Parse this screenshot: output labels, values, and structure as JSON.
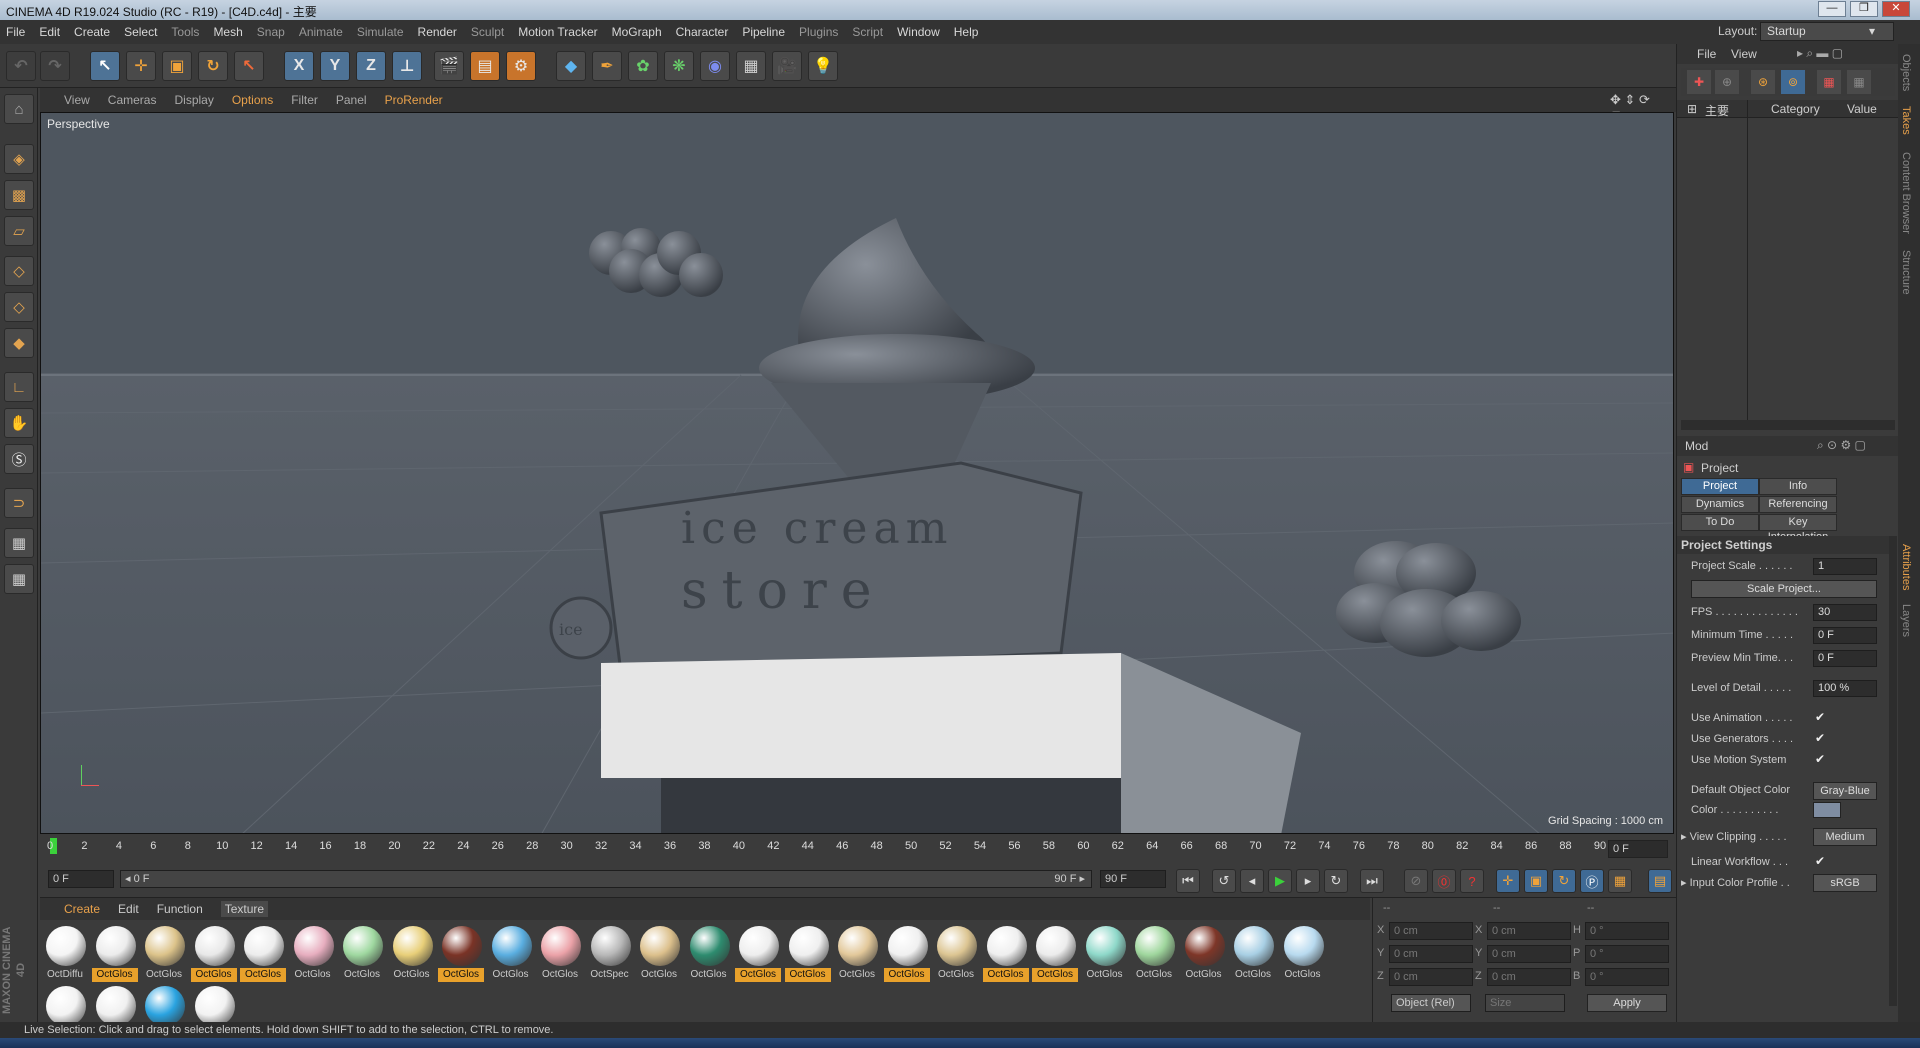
{
  "window": {
    "title": "CINEMA 4D R19.024 Studio (RC - R19) - [C4D.c4d] - 主要",
    "min": "—",
    "max": "❐",
    "close": "✕"
  },
  "menu": [
    "File",
    "Edit",
    "Create",
    "Select",
    "Tools",
    "Mesh",
    "Snap",
    "Animate",
    "Simulate",
    "Render",
    "Sculpt",
    "Motion Tracker",
    "MoGraph",
    "Character",
    "Pipeline",
    "Plugins",
    "Script",
    "Window",
    "Help"
  ],
  "layout": {
    "label": "Layout:",
    "value": "Startup"
  },
  "toolbar": {
    "x": "X",
    "y": "Y",
    "z": "Z"
  },
  "viewport_menu": [
    "View",
    "Cameras",
    "Display",
    "Options",
    "Filter",
    "Panel",
    "ProRender"
  ],
  "viewport": {
    "label": "Perspective",
    "grid_spacing": "Grid Spacing : 1000 cm",
    "sign_line1": "ice cream",
    "sign_line2": "store",
    "badge": "ice"
  },
  "timeline": {
    "ticks": [
      "0",
      "2",
      "4",
      "6",
      "8",
      "10",
      "12",
      "14",
      "16",
      "18",
      "20",
      "22",
      "24",
      "26",
      "28",
      "30",
      "32",
      "34",
      "36",
      "38",
      "40",
      "42",
      "44",
      "46",
      "48",
      "50",
      "52",
      "54",
      "56",
      "58",
      "60",
      "62",
      "64",
      "66",
      "68",
      "70",
      "72",
      "74",
      "76",
      "78",
      "80",
      "82",
      "84",
      "86",
      "88",
      "90"
    ],
    "current_frame": "0 F"
  },
  "transport": {
    "start": "0 F",
    "slider_start": "◂ 0 F",
    "slider_end": "90 F ▸",
    "end": "90 F"
  },
  "material_tabs": [
    "Create",
    "Edit",
    "Function",
    "Texture"
  ],
  "materials": [
    {
      "label": "OctDiffu",
      "color": "#f4f4f4",
      "sel": false
    },
    {
      "label": "OctGlos",
      "color": "#ececec",
      "sel": true
    },
    {
      "label": "OctGlos",
      "color": "#dcc38a",
      "sel": false
    },
    {
      "label": "OctGlos",
      "color": "#e8e8e8",
      "sel": true
    },
    {
      "label": "OctGlos",
      "color": "#ededed",
      "sel": true
    },
    {
      "label": "OctGlos",
      "color": "#e7aebf",
      "sel": false
    },
    {
      "label": "OctGlos",
      "color": "#9fd8a0",
      "sel": false
    },
    {
      "label": "OctGlos",
      "color": "#e8cf79",
      "sel": false
    },
    {
      "label": "OctGlos",
      "color": "#7a3326",
      "sel": true
    },
    {
      "label": "OctGlos",
      "color": "#5aaee0",
      "sel": false
    },
    {
      "label": "OctGlos",
      "color": "#eba2a8",
      "sel": false
    },
    {
      "label": "OctSpec",
      "color": "#b8b8b8",
      "sel": false
    },
    {
      "label": "OctGlos",
      "color": "#dcc08c",
      "sel": false
    },
    {
      "label": "OctGlos",
      "color": "#2e8c6f",
      "sel": false
    },
    {
      "label": "OctGlos",
      "color": "#eeeeee",
      "sel": true
    },
    {
      "label": "OctGlos",
      "color": "#efefef",
      "sel": true
    },
    {
      "label": "OctGlos",
      "color": "#e2c89a",
      "sel": false
    },
    {
      "label": "OctGlos",
      "color": "#f0f0f0",
      "sel": true
    },
    {
      "label": "OctGlos",
      "color": "#dcc592",
      "sel": false
    },
    {
      "label": "OctGlos",
      "color": "#efefef",
      "sel": true
    },
    {
      "label": "OctGlos",
      "color": "#ececec",
      "sel": true
    },
    {
      "label": "OctGlos",
      "color": "#8ed8c9",
      "sel": false
    },
    {
      "label": "OctGlos",
      "color": "#9fd69d",
      "sel": false
    },
    {
      "label": "OctGlos",
      "color": "#7e3628",
      "sel": false
    },
    {
      "label": "OctGlos",
      "color": "#a8cfe4",
      "sel": false
    },
    {
      "label": "OctGlos",
      "color": "#b8daef",
      "sel": false
    }
  ],
  "materials_row2": [
    "#f2f2f2",
    "#f0f0f0",
    "#2aa3e0",
    "#f2f2f2"
  ],
  "coords": {
    "dashes": [
      "--",
      "--",
      "--"
    ],
    "rows": [
      {
        "a": "X",
        "av": "0 cm",
        "b": "X",
        "bv": "0 cm",
        "c": "H",
        "cv": "0 °"
      },
      {
        "a": "Y",
        "av": "0 cm",
        "b": "Y",
        "bv": "0 cm",
        "c": "P",
        "cv": "0 °"
      },
      {
        "a": "Z",
        "av": "0 cm",
        "b": "Z",
        "bv": "0 cm",
        "c": "B",
        "cv": "0 °"
      }
    ],
    "mode": "Object (Rel)",
    "size": "Size",
    "apply": "Apply"
  },
  "objects": {
    "menu": [
      "File",
      "View"
    ],
    "tree_root": "主要",
    "col_category": "Category",
    "col_value": "Value"
  },
  "attributes": {
    "mode": "Mod",
    "title": "Project",
    "tabs": [
      "Project Settings",
      "Info",
      "Dynamics",
      "Referencing",
      "To Do",
      "Key Interpolation"
    ],
    "section": "Project Settings",
    "scale_btn": "Scale Project...",
    "rows": [
      {
        "label": "Project Scale . . . . . .",
        "value": "1"
      },
      {
        "label": "FPS . . . . . . . . . . . . . .",
        "value": "30"
      },
      {
        "label": "Minimum Time . . . . .",
        "value": "0 F"
      },
      {
        "label": "Preview Min Time. . .",
        "value": "0 F"
      },
      {
        "label": "Level of Detail . . . . .",
        "value": "100 %"
      }
    ],
    "checks": [
      {
        "label": "Use Animation . . . . .",
        "mark": "✔"
      },
      {
        "label": "Use Generators . . . .",
        "mark": "✔"
      },
      {
        "label": "Use Motion System",
        "mark": "✔"
      }
    ],
    "default_color": {
      "label": "Default Object Color",
      "value": "Gray-Blue"
    },
    "color": {
      "label": "Color . . . . . . . . . .",
      "swatch": "#7f8da2"
    },
    "clipping": {
      "label": "View Clipping . . . . .",
      "value": "Medium"
    },
    "linear": {
      "label": "Linear Workflow . . .",
      "mark": "✔"
    },
    "profile": {
      "label": "Input Color Profile . .",
      "value": "sRGB"
    }
  },
  "side_tabs": [
    "Objects",
    "Takes",
    "Content Browser",
    "Structure",
    "Attributes",
    "Layers"
  ],
  "status": "Live Selection: Click and drag to select elements. Hold down SHIFT to add to the selection, CTRL to remove."
}
